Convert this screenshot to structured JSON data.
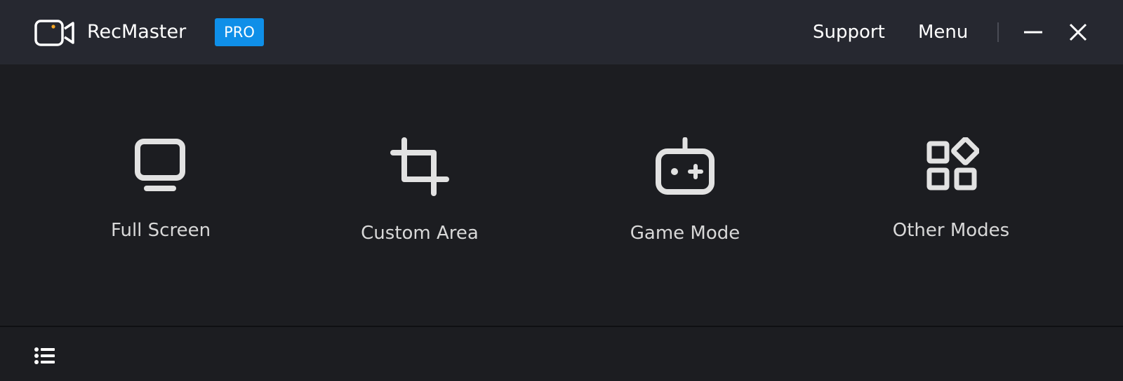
{
  "app": {
    "name": "RecMaster",
    "badge": "PRO",
    "logo_icon": "camera-icon",
    "accent_color": "#0f8fe8",
    "logo_dot_color": "#f5a623"
  },
  "titlebar": {
    "support_label": "Support",
    "menu_label": "Menu",
    "minimize_icon": "minimize-icon",
    "close_icon": "close-icon"
  },
  "modes": [
    {
      "label": "Full Screen",
      "icon": "monitor-icon"
    },
    {
      "label": "Custom Area",
      "icon": "crop-icon"
    },
    {
      "label": "Game Mode",
      "icon": "gamepad-icon"
    },
    {
      "label": "Other Modes",
      "icon": "grid-icon"
    }
  ],
  "footer": {
    "list_icon": "list-icon"
  }
}
